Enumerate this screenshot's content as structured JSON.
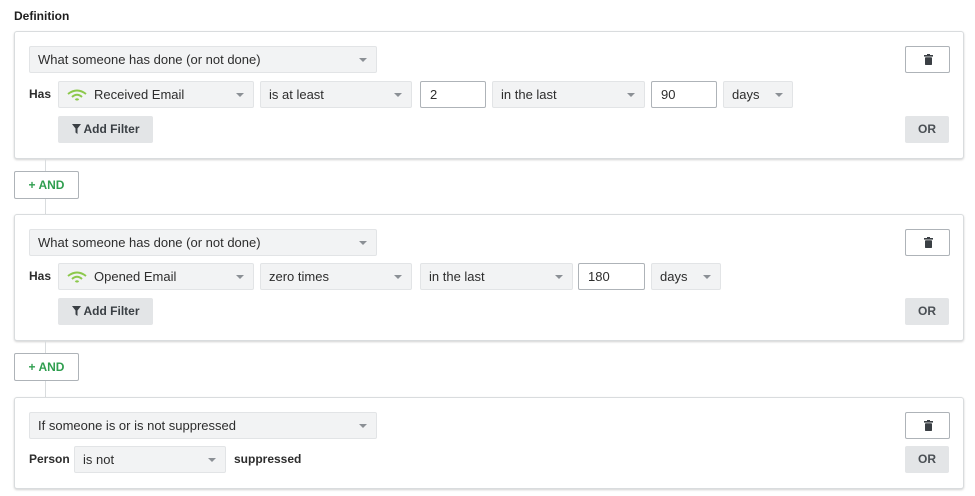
{
  "heading": "Definition",
  "conditions": [
    {
      "type_select": "What someone has done (or not done)",
      "subject_label": "Has",
      "metric": "Received Email",
      "operator": "is at least",
      "count": "2",
      "timeframe": "in the last",
      "amount": "90",
      "unit": "days",
      "add_filter_label": "Add Filter",
      "or_label": "OR"
    },
    {
      "type_select": "What someone has done (or not done)",
      "subject_label": "Has",
      "metric": "Opened Email",
      "operator": "zero times",
      "timeframe": "in the last",
      "amount": "180",
      "unit": "days",
      "add_filter_label": "Add Filter",
      "or_label": "OR"
    },
    {
      "type_select": "If someone is or is not suppressed",
      "subject_label": "Person",
      "operator": "is not",
      "value_text": "suppressed",
      "or_label": "OR"
    }
  ],
  "and_label": "+ AND",
  "icons": {
    "delete": "trash-icon",
    "metric": "signal-icon",
    "filter": "funnel-icon"
  },
  "colors": {
    "accent_green": "#2f9e4f",
    "metric_icon_green": "#8cc84b"
  }
}
